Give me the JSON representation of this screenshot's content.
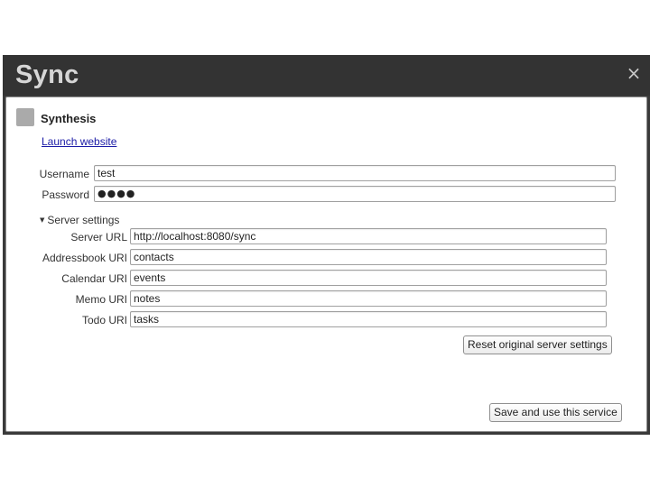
{
  "dialog": {
    "title": "Sync",
    "close_label": "×"
  },
  "service": {
    "name": "Synthesis",
    "icon": "service-icon",
    "launch_link": "Launch website"
  },
  "credentials": {
    "username_label": "Username",
    "username_value": "test",
    "password_label": "Password",
    "password_value": "●●●●"
  },
  "server_settings": {
    "expander_label": "Server settings",
    "arrow": "▼",
    "server_url_label": "Server URL",
    "server_url_value": "http://localhost:8080/sync",
    "addressbook_label": "Addressbook URI",
    "addressbook_value": "contacts",
    "calendar_label": "Calendar URI",
    "calendar_value": "events",
    "memo_label": "Memo URI",
    "memo_value": "notes",
    "todo_label": "Todo URI",
    "todo_value": "tasks",
    "reset_button": "Reset original server settings"
  },
  "actions": {
    "save_button": "Save and use this service"
  }
}
